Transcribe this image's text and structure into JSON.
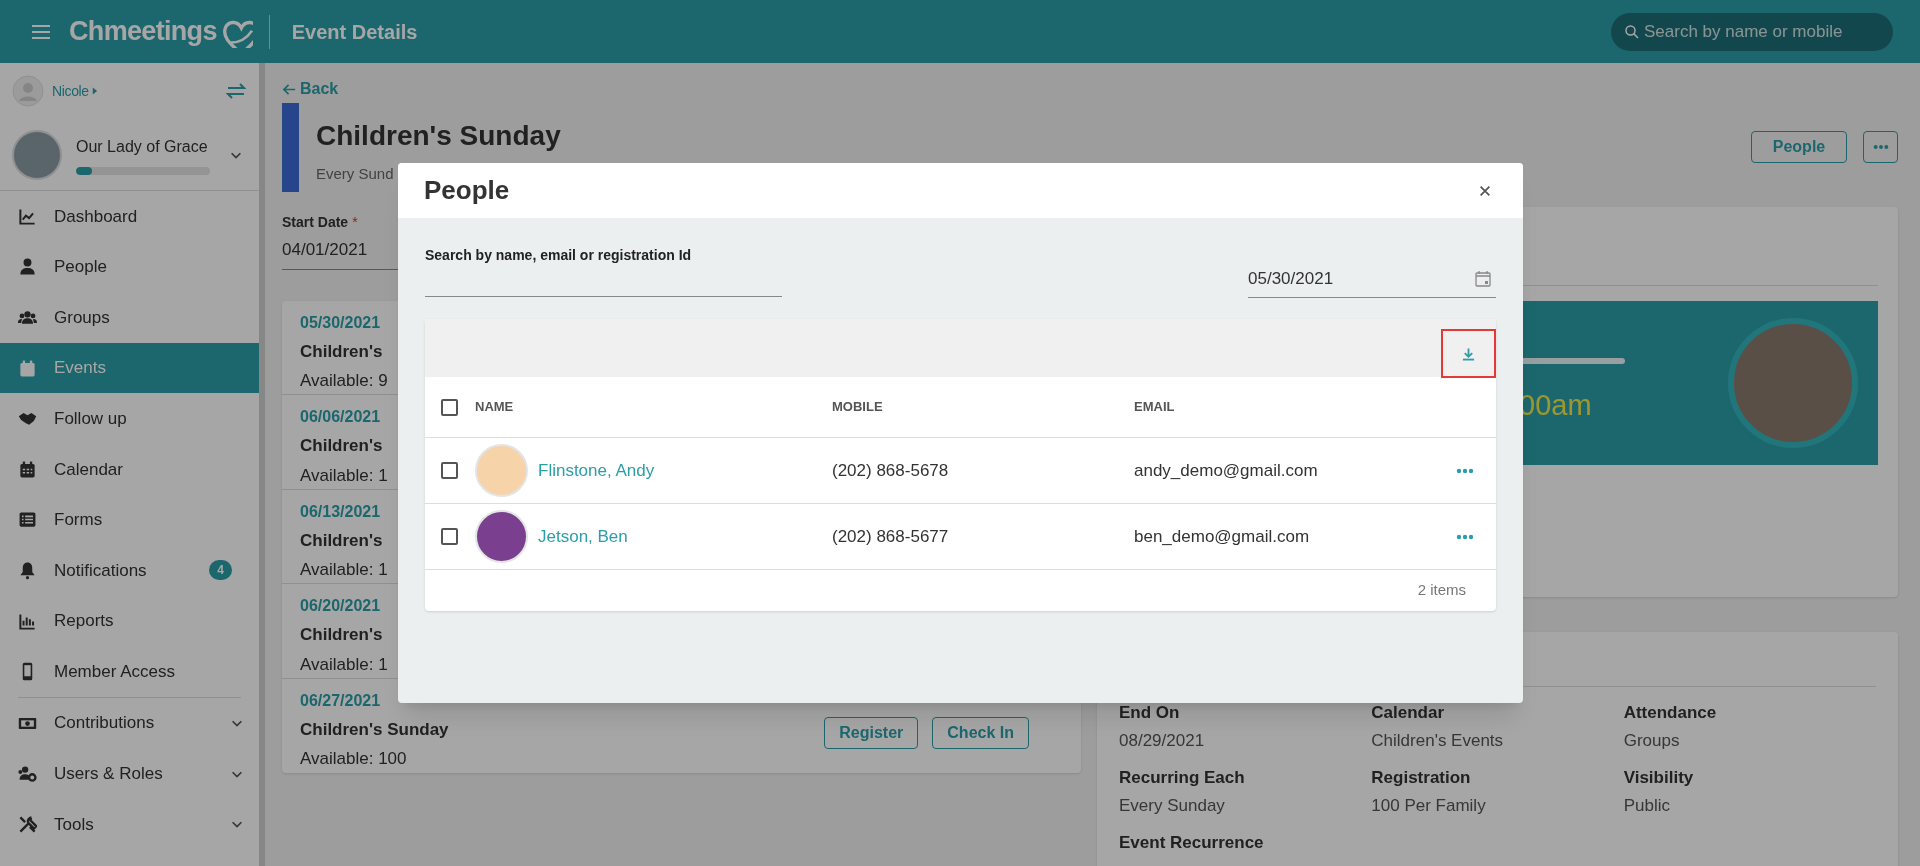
{
  "top_bar": {
    "logo": "Chmeetings",
    "page_title": "Event Details",
    "search": {
      "placeholder": "Search by name or mobile"
    }
  },
  "sidebar": {
    "user": "Nicole",
    "organization": {
      "name": "Our Lady of Grace",
      "level": 0.12
    },
    "items": [
      {
        "label": "Dashboard",
        "selected": false,
        "expandable": false
      },
      {
        "label": "People",
        "selected": false,
        "expandable": false
      },
      {
        "label": "Groups",
        "selected": false,
        "expandable": false
      },
      {
        "label": "Events",
        "selected": true,
        "expandable": false
      },
      {
        "label": "Follow up",
        "selected": false,
        "expandable": false
      },
      {
        "label": "Calendar",
        "selected": false,
        "expandable": false
      },
      {
        "label": "Forms",
        "selected": false,
        "expandable": false
      },
      {
        "label": "Notifications",
        "selected": false,
        "expandable": false,
        "badge": "4"
      },
      {
        "label": "Reports",
        "selected": false,
        "expandable": false
      },
      {
        "label": "Member Access",
        "selected": false,
        "expandable": false
      },
      {
        "label": "Contributions",
        "selected": false,
        "expandable": true
      },
      {
        "label": "Users & Roles",
        "selected": false,
        "expandable": true
      },
      {
        "label": "Tools",
        "selected": false,
        "expandable": true
      }
    ]
  },
  "event": {
    "back": "Back",
    "title": "Children's Sunday",
    "subtitle": "Every Sund",
    "people_button": "People",
    "start_date": {
      "label": "Start Date",
      "required_mark": "*",
      "value": "04/01/2021"
    },
    "occurrences": [
      {
        "date": "05/30/2021",
        "title": "Children's",
        "available": "Available: 9"
      },
      {
        "date": "06/06/2021",
        "title": "Children's",
        "available": "Available: 1"
      },
      {
        "date": "06/13/2021",
        "title": "Children's",
        "available": "Available: 1"
      },
      {
        "date": "06/20/2021",
        "title": "Children's",
        "available": "Available: 1"
      },
      {
        "date": "06/27/2021",
        "title": "Children's Sunday",
        "available": "Available: 100",
        "actions": [
          "Register",
          "Check In"
        ]
      }
    ],
    "banner_text": "00am",
    "fields": [
      {
        "label": "End On",
        "value": "08/29/2021"
      },
      {
        "label": "Calendar",
        "value": "Children's Events"
      },
      {
        "label": "Attendance",
        "value": "Groups"
      },
      {
        "label": "Recurring Each",
        "value": "Every Sunday"
      },
      {
        "label": "Registration",
        "value": "100 Per Family"
      },
      {
        "label": "Visibility",
        "value": "Public"
      },
      {
        "label": "Event Recurrence"
      }
    ]
  },
  "modal": {
    "title": "People",
    "search": {
      "label": "Search by name, email or registration Id"
    },
    "date": "05/30/2021",
    "download_highlighted": true,
    "select_all": false,
    "columns": [
      "NAME",
      "MOBILE",
      "EMAIL"
    ],
    "rows": [
      {
        "name": "Flinstone, Andy",
        "mobile": "(202) 868-5678",
        "email": "andy_demo@gmail.com",
        "checked": false,
        "color": "#f6d3a8"
      },
      {
        "name": "Jetson, Ben",
        "mobile": "(202) 868-5677",
        "email": "ben_demo@gmail.com",
        "checked": false,
        "color": "#7b3f8f"
      }
    ],
    "footer": "2 items"
  }
}
